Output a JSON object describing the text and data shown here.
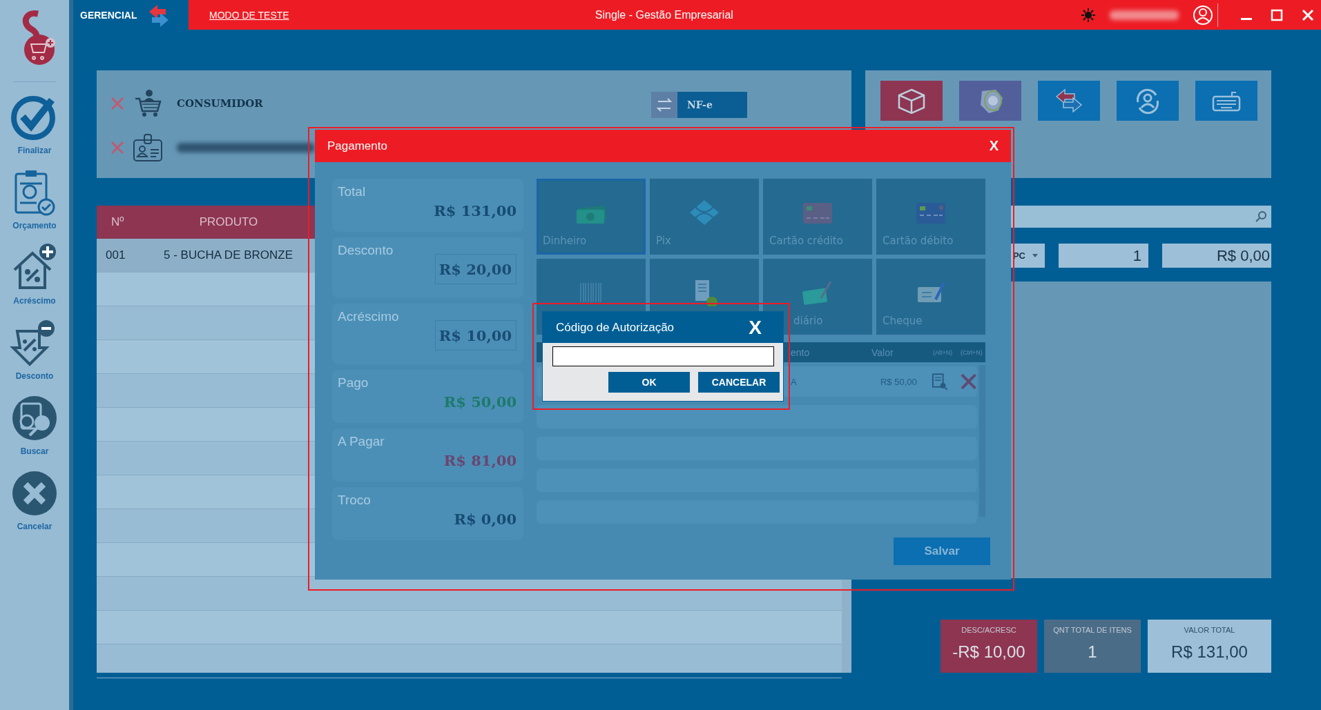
{
  "top_bar": {
    "mode": "GERENCIAL",
    "test_mode_link": "MODO DE TESTE",
    "title": "Single - Gestão Empresarial",
    "user_blurred": true
  },
  "sidebar": {
    "items": [
      {
        "label": "Finalizar",
        "kind": "check"
      },
      {
        "label": "Orçamento",
        "kind": "quote"
      },
      {
        "label": "Acréscimo",
        "kind": "add"
      },
      {
        "label": "Desconto",
        "kind": "discount"
      },
      {
        "label": "Buscar",
        "kind": "search"
      },
      {
        "label": "Cancelar",
        "kind": "cancel"
      }
    ]
  },
  "customer": {
    "rows": [
      {
        "kind": "consumer",
        "label": "CONSUMIDOR"
      },
      {
        "kind": "person",
        "blurred": true
      }
    ],
    "nfe_button": "NF-e"
  },
  "table": {
    "columns": [
      "Nº",
      "PRODUTO"
    ],
    "rows": [
      [
        "001",
        "5 - BUCHA DE BRONZE"
      ]
    ]
  },
  "toolbar": {
    "buttons": [
      {
        "kind": "box",
        "color": "#8e3551"
      },
      {
        "kind": "nfe",
        "color": "#525f9a"
      },
      {
        "kind": "swap",
        "color": "#0b6fb2"
      },
      {
        "kind": "user_sync",
        "color": "#0b6fb2"
      },
      {
        "kind": "keyboard",
        "color": "#0b6fb2"
      }
    ]
  },
  "product_entry": {
    "unit": "PC",
    "quantity": "1",
    "price": "R$ 0,00"
  },
  "totals": [
    {
      "label": "DESC/ACRESC",
      "value": "-R$ 10,00",
      "color": "#8e3551"
    },
    {
      "label": "QNT TOTAL DE ITENS",
      "value": "1",
      "color": "#4b6c87"
    },
    {
      "label": "VALOR TOTAL",
      "value": "R$ 131,00",
      "color": "#9dc0d8"
    }
  ],
  "payment_dialog": {
    "title": "Pagamento",
    "close": "X",
    "summary": [
      {
        "label": "Total",
        "value": "R$ 131,00",
        "kind": "plain",
        "color": "#174b72"
      },
      {
        "label": "Desconto",
        "value": "R$ 20,00",
        "kind": "boxed",
        "color": "#1b4c74"
      },
      {
        "label": "Acréscimo",
        "value": "R$ 10,00",
        "kind": "boxed",
        "color": "#1b4c74"
      },
      {
        "label": "Pago",
        "value": "R$ 50,00",
        "kind": "plain",
        "color": "#1d7a6b"
      },
      {
        "label": "A Pagar",
        "value": "R$ 81,00",
        "kind": "plain",
        "color": "#6a4570"
      },
      {
        "label": "Troco",
        "value": "R$ 0,00",
        "kind": "plain",
        "color": "#174b72"
      }
    ],
    "methods": [
      {
        "label": "Dinheiro",
        "kind": "cash",
        "selected": true
      },
      {
        "label": "Pix",
        "kind": "pix",
        "selected": false
      },
      {
        "label": "Cartão crédito",
        "kind": "credit",
        "selected": false
      },
      {
        "label": "Cartão débito",
        "kind": "debit",
        "selected": false
      },
      {
        "kind": "boleto",
        "selected": false
      },
      {
        "kind": "receipt",
        "selected": false
      },
      {
        "label": "diário",
        "kind": "card_pen",
        "selected": false,
        "clipped": true
      },
      {
        "label": "Cheque",
        "kind": "cheque",
        "selected": false
      }
    ],
    "list": {
      "columns": [
        "ento",
        "Valor",
        "(Alt+N)",
        "(Ctrl+N)"
      ],
      "rows": [
        {
          "cells": [
            "A",
            "R$ 50,00"
          ]
        }
      ]
    },
    "save_button": "Salvar"
  },
  "auth_dialog": {
    "title": "Código de Autorização",
    "close": "X",
    "buttons": [
      "OK",
      "CANCELAR"
    ]
  }
}
